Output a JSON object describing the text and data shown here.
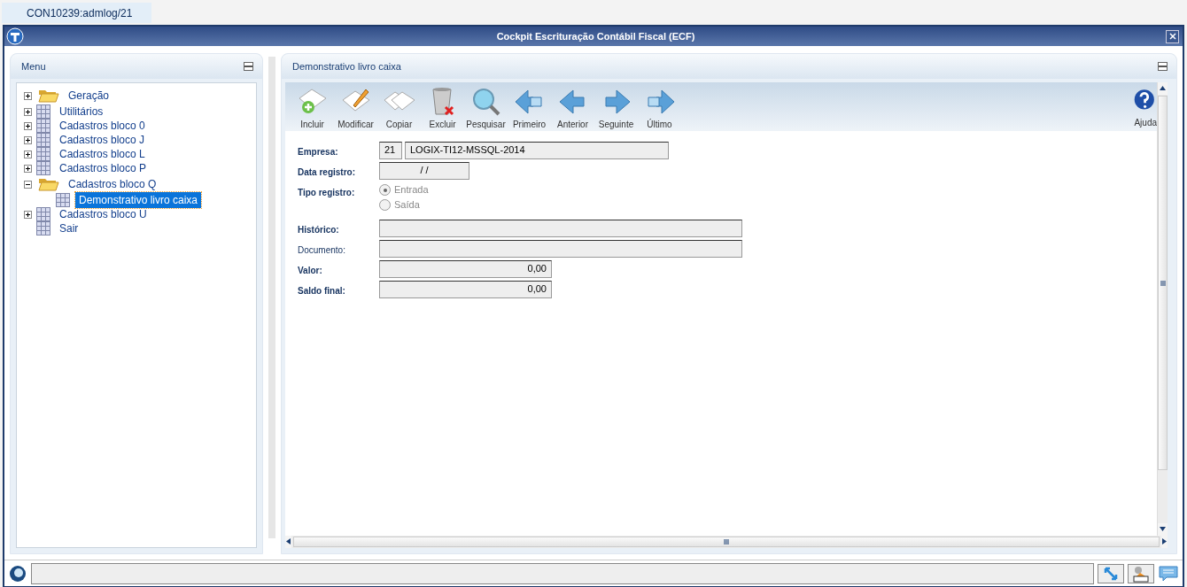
{
  "session_tab": {
    "label": "CON10239:admlog/21"
  },
  "window": {
    "title": "Cockpit Escrituração Contábil Fiscal (ECF)"
  },
  "menu": {
    "title": "Menu",
    "items": [
      {
        "label": "Geração",
        "kind": "folder",
        "expanded": false,
        "selected": false
      },
      {
        "label": "Utilitários",
        "kind": "grid",
        "expanded": false,
        "selected": false
      },
      {
        "label": "Cadastros bloco 0",
        "kind": "grid",
        "expanded": false,
        "selected": false
      },
      {
        "label": "Cadastros bloco J",
        "kind": "grid",
        "expanded": false,
        "selected": false
      },
      {
        "label": "Cadastros bloco L",
        "kind": "grid",
        "expanded": false,
        "selected": false
      },
      {
        "label": "Cadastros bloco P",
        "kind": "grid",
        "expanded": false,
        "selected": false
      },
      {
        "label": "Cadastros bloco Q",
        "kind": "folder",
        "expanded": true,
        "selected": false,
        "children": [
          {
            "label": "Demonstrativo livro caixa",
            "kind": "grid",
            "selected": true
          }
        ]
      },
      {
        "label": "Cadastros bloco U",
        "kind": "grid",
        "expanded": false,
        "selected": false
      },
      {
        "label": "Sair",
        "kind": "grid",
        "selected": false
      }
    ]
  },
  "panel": {
    "title": "Demonstrativo livro caixa",
    "toolbar": [
      {
        "label": "Incluir",
        "kind": "add"
      },
      {
        "label": "Modificar",
        "kind": "edit"
      },
      {
        "label": "Copiar",
        "kind": "copy"
      },
      {
        "label": "Excluir",
        "kind": "delete"
      },
      {
        "label": "Pesquisar",
        "kind": "search"
      },
      {
        "label": "Primeiro",
        "kind": "first"
      },
      {
        "label": "Anterior",
        "kind": "prev"
      },
      {
        "label": "Seguinte",
        "kind": "next"
      },
      {
        "label": "Último",
        "kind": "last"
      }
    ],
    "help": {
      "label": "Ajuda"
    },
    "fields": [
      {
        "label": "Empresa:",
        "kind": "code",
        "required": true,
        "code": "21",
        "value": "LOGIX-TI12-MSSQL-2014"
      },
      {
        "label": "Data registro:",
        "kind": "date",
        "required": true,
        "value": "/ /"
      },
      {
        "label": "Tipo registro:",
        "kind": "radio",
        "required": true,
        "options": [
          {
            "label": "Entrada",
            "selected": true,
            "disabled": true
          },
          {
            "label": "Saída",
            "selected": false,
            "disabled": true
          }
        ]
      },
      {
        "label": "Histórico:",
        "kind": "wide",
        "required": true
      },
      {
        "label": "Documento:",
        "kind": "wide",
        "required": false
      },
      {
        "label": "Valor:",
        "kind": "number",
        "required": true,
        "value": "0,00"
      },
      {
        "label": "Saldo final:",
        "kind": "number",
        "required": true,
        "value": "0,00"
      }
    ]
  }
}
